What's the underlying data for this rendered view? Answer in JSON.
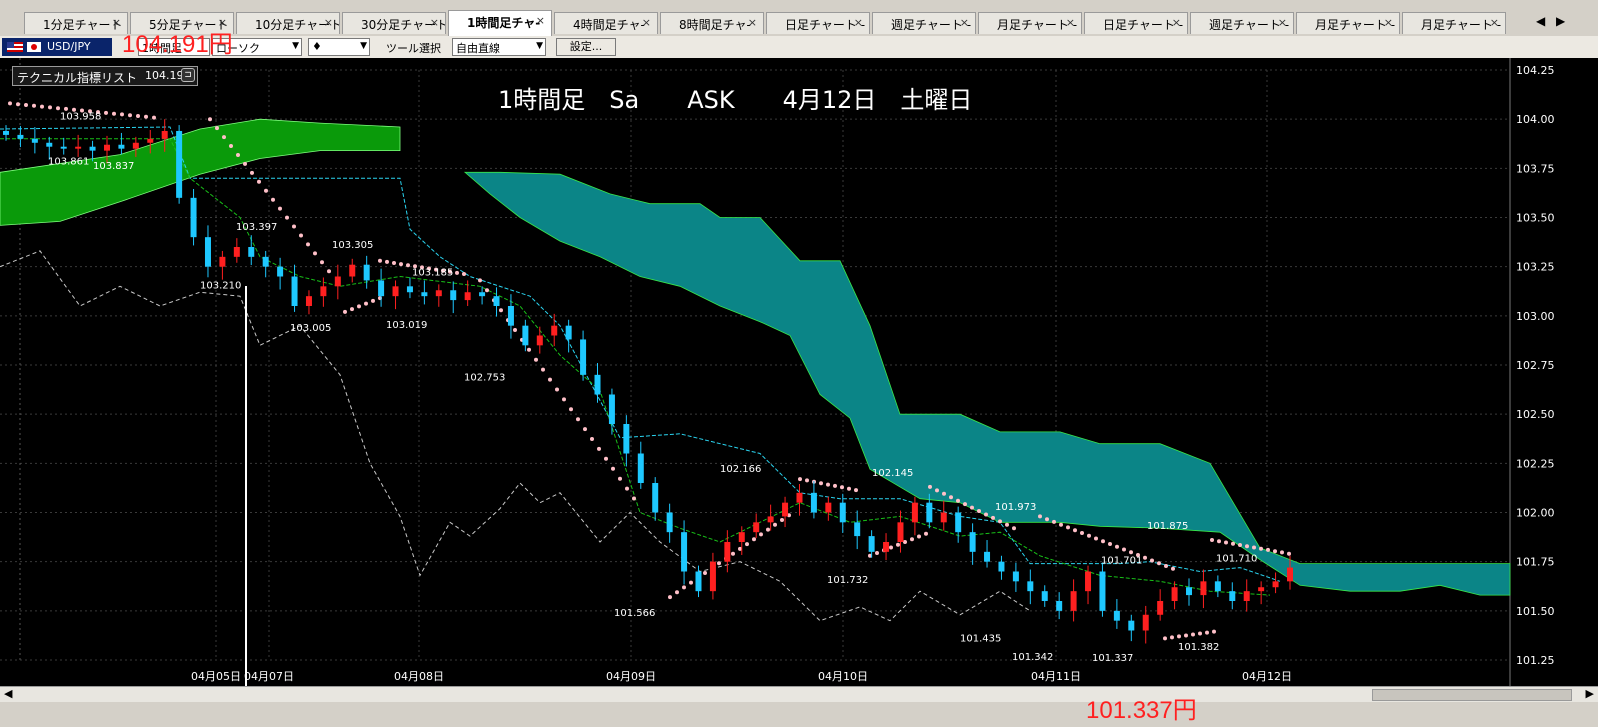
{
  "tabs": [
    {
      "label": "1分足チャート",
      "active": false
    },
    {
      "label": "5分足チャート",
      "active": false
    },
    {
      "label": "10分足チャート",
      "active": false
    },
    {
      "label": "30分足チャート",
      "active": false
    },
    {
      "label": "1時間足チャ-",
      "active": true
    },
    {
      "label": "4時間足チャ-",
      "active": false
    },
    {
      "label": "8時間足チャ-",
      "active": false
    },
    {
      "label": "日足チャート -",
      "active": false
    },
    {
      "label": "週足チャート -",
      "active": false
    },
    {
      "label": "月足チャート -",
      "active": false
    },
    {
      "label": "日足チャート -",
      "active": false
    },
    {
      "label": "週足チャート -",
      "active": false
    },
    {
      "label": "月足チャート -",
      "active": false
    },
    {
      "label": "月足チャート -",
      "active": false
    }
  ],
  "tab_close": "×",
  "tab_nav": {
    "left": "◀",
    "right": "▶"
  },
  "toolbar": {
    "symbol": "USD/JPY",
    "timeframe": "1時間足",
    "candle_type": "ローソク",
    "marker": "♦",
    "tool_label": "ツール選択",
    "tool_value": "自由直線",
    "settings_button": "設定..."
  },
  "overlay": {
    "price_top": "104.191円",
    "price_bottom": "101.337円",
    "title": "1時間足　Sa　　ASK　　4月12日　土曜日"
  },
  "indicator_box": {
    "label": "テクニカル指標リスト",
    "value": "104.19",
    "icon_glyph": "⊐"
  },
  "colors": {
    "up_candle": "#ff2020",
    "down_candle": "#1ec8ff",
    "cloud_green": "#0a9a0a",
    "cloud_teal": "#0b8587",
    "parabolic": "#ffc0c8",
    "chikou": "#c8c8c8",
    "tenkan": "#2ad4f0",
    "kijun": "#18c018"
  },
  "scroll": {
    "left": "◀",
    "right": "▶"
  },
  "chart_data": {
    "type": "candlestick",
    "instrument": "USD/JPY",
    "timeframe": "1時間足",
    "ylim": [
      101.25,
      104.25
    ],
    "y_ticks": [
      "104.25",
      "104.00",
      "103.75",
      "103.50",
      "103.25",
      "103.00",
      "102.75",
      "102.50",
      "102.25",
      "102.00",
      "101.75",
      "101.50",
      "101.25"
    ],
    "x_ticks": [
      "04月05日",
      "04月07日",
      "04月08日",
      "04月09日",
      "04月10日",
      "04月11日",
      "04月12日"
    ],
    "annotations": [
      {
        "text": "103.958",
        "value": 103.958
      },
      {
        "text": "103.861",
        "value": 103.861
      },
      {
        "text": "103.837",
        "value": 103.837
      },
      {
        "text": "103.397",
        "value": 103.397
      },
      {
        "text": "103.210",
        "value": 103.21
      },
      {
        "text": "103.305",
        "value": 103.305
      },
      {
        "text": "103.005",
        "value": 103.005
      },
      {
        "text": "103.185",
        "value": 103.185
      },
      {
        "text": "103.019",
        "value": 103.019
      },
      {
        "text": "102.753",
        "value": 102.753
      },
      {
        "text": "101.566",
        "value": 101.566
      },
      {
        "text": "102.166",
        "value": 102.166
      },
      {
        "text": "101.732",
        "value": 101.732
      },
      {
        "text": "102.145",
        "value": 102.145
      },
      {
        "text": "101.973",
        "value": 101.973
      },
      {
        "text": "101.435",
        "value": 101.435
      },
      {
        "text": "101.342",
        "value": 101.342
      },
      {
        "text": "101.701",
        "value": 101.701
      },
      {
        "text": "101.875",
        "value": 101.875
      },
      {
        "text": "101.337",
        "value": 101.337
      },
      {
        "text": "101.710",
        "value": 101.71
      },
      {
        "text": "101.382",
        "value": 101.382
      }
    ],
    "close_series": [
      103.92,
      103.9,
      103.88,
      103.86,
      103.85,
      103.86,
      103.84,
      103.87,
      103.85,
      103.88,
      103.9,
      103.94,
      103.6,
      103.4,
      103.25,
      103.3,
      103.35,
      103.3,
      103.25,
      103.2,
      103.05,
      103.1,
      103.15,
      103.2,
      103.26,
      103.18,
      103.1,
      103.15,
      103.12,
      103.1,
      103.13,
      103.08,
      103.12,
      103.1,
      103.05,
      102.95,
      102.85,
      102.9,
      102.95,
      102.88,
      102.7,
      102.6,
      102.45,
      102.3,
      102.15,
      102.0,
      101.9,
      101.7,
      101.6,
      101.75,
      101.85,
      101.9,
      101.95,
      101.98,
      102.05,
      102.1,
      102.0,
      102.05,
      101.95,
      101.88,
      101.8,
      101.85,
      101.95,
      102.05,
      101.95,
      102.0,
      101.9,
      101.8,
      101.75,
      101.7,
      101.65,
      101.6,
      101.55,
      101.5,
      101.6,
      101.7,
      101.5,
      101.45,
      101.4,
      101.48,
      101.55,
      101.62,
      101.58,
      101.65,
      101.6,
      101.55,
      101.6,
      101.62,
      101.65,
      101.72
    ]
  }
}
